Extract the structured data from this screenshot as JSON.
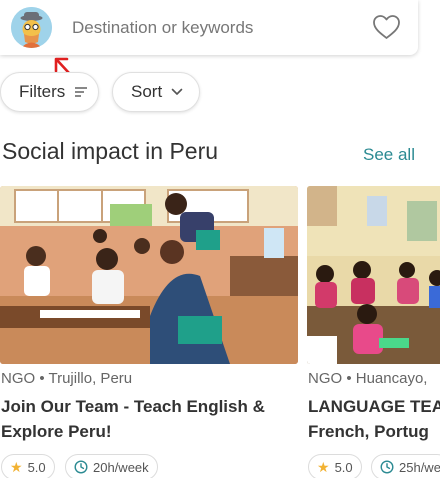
{
  "search": {
    "placeholder": "Destination or keywords"
  },
  "chips": {
    "filters_label": "Filters",
    "sort_label": "Sort"
  },
  "section": {
    "title": "Social impact in Peru",
    "see_all": "See all"
  },
  "cards": [
    {
      "meta": "NGO • Trujillo, Peru",
      "title_line1": "Join Our Team - Teach English &",
      "title_line2": "Explore Peru!",
      "rating": "5.0",
      "hours": "20h/week"
    },
    {
      "meta": "NGO • Huancayo,",
      "title_line1": "LANGUAGE TEA",
      "title_line2": "French, Portug",
      "rating": "5.0",
      "hours": "25h/we"
    }
  ],
  "colors": {
    "accent": "#2b8a92",
    "star": "#f2b233",
    "annotation_arrow": "#e02020"
  },
  "icons": {
    "avatar": "traveler-avatar",
    "favorite": "heart-icon",
    "filters": "filter-lines-icon",
    "sort": "chevron-down-icon",
    "rating": "star-icon",
    "hours": "clock-icon"
  }
}
